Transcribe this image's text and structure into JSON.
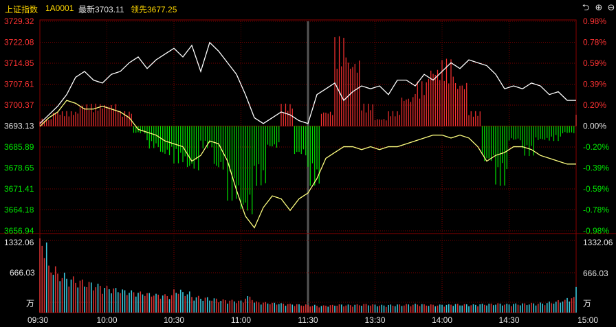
{
  "header": {
    "title": "上证指数",
    "code": "1A0001",
    "latest_label": "最新3703.11",
    "leading_label": "领先3677.25",
    "buttons": [
      "back",
      "zoom-in",
      "zoom-out"
    ]
  },
  "colors": {
    "background": "#000000",
    "up": "#ff3232",
    "down": "#00e600",
    "neutral": "#e6e6e6",
    "index_line": "#ffffff",
    "leading_line": "#ffff80",
    "volume_up": "#d93232",
    "volume_down": "#3cc8dc",
    "grid": "#7a0000"
  },
  "chart_data": {
    "type": "line",
    "base_price": 3693.13,
    "price_ticks": [
      "3729.32",
      "3722.08",
      "3714.85",
      "3707.61",
      "3700.37",
      "3693.13",
      "3685.89",
      "3678.65",
      "3671.41",
      "3664.18",
      "3656.94"
    ],
    "pct_ticks": [
      "0.98%",
      "0.78%",
      "0.59%",
      "0.39%",
      "0.20%",
      "0.00%",
      "-0.20%",
      "-0.39%",
      "-0.59%",
      "-0.78%",
      "-0.98%"
    ],
    "ylim": [
      3656.94,
      3729.32
    ],
    "time_ticks": [
      "09:30",
      "10:00",
      "10:30",
      "11:00",
      "11:30",
      "13:30",
      "14:00",
      "14:30",
      "15:00"
    ],
    "series": [
      {
        "name": "最新",
        "color": "#ffffff",
        "x": [
          0,
          4,
          8,
          12,
          16,
          20,
          24,
          28,
          32,
          36,
          40,
          44,
          48,
          52,
          56,
          60,
          64,
          68,
          72,
          76,
          80,
          84,
          88,
          92,
          96,
          100,
          104,
          108,
          112,
          116,
          120,
          124,
          128,
          132,
          136,
          140,
          144,
          148,
          152,
          156,
          160,
          164,
          168,
          172,
          176,
          180,
          184,
          188,
          192,
          196,
          200,
          204,
          208,
          212,
          216,
          220,
          224,
          228,
          232,
          236,
          240
        ],
        "y": [
          3694,
          3697,
          3700,
          3704,
          3710,
          3712,
          3709,
          3708,
          3711,
          3712,
          3715,
          3717,
          3713,
          3716,
          3718,
          3720,
          3717,
          3721,
          3712,
          3722,
          3719,
          3715,
          3711,
          3704,
          3696,
          3694,
          3696,
          3698,
          3697,
          3695,
          3694,
          3704,
          3706,
          3708,
          3702,
          3705,
          3707,
          3706,
          3707,
          3704,
          3709,
          3709,
          3707,
          3711,
          3709,
          3712,
          3715,
          3713,
          3716,
          3715,
          3714,
          3711,
          3706,
          3707,
          3706,
          3708,
          3707,
          3704,
          3705,
          3702,
          3702
        ]
      },
      {
        "name": "领先",
        "color": "#ffff80",
        "x": [
          0,
          4,
          8,
          12,
          16,
          20,
          24,
          28,
          32,
          36,
          40,
          44,
          48,
          52,
          56,
          60,
          64,
          68,
          72,
          76,
          80,
          84,
          88,
          92,
          96,
          100,
          104,
          108,
          112,
          116,
          120,
          124,
          128,
          132,
          136,
          140,
          144,
          148,
          152,
          156,
          160,
          164,
          168,
          172,
          176,
          180,
          184,
          188,
          192,
          196,
          200,
          204,
          208,
          212,
          216,
          220,
          224,
          228,
          232,
          236,
          240
        ],
        "y": [
          3693,
          3696,
          3698,
          3702,
          3701,
          3699,
          3699,
          3700,
          3699,
          3698,
          3696,
          3692,
          3691,
          3690,
          3688,
          3687,
          3686,
          3681,
          3683,
          3688,
          3687,
          3681,
          3671,
          3662,
          3658,
          3665,
          3669,
          3668,
          3664,
          3668,
          3670,
          3675,
          3682,
          3684,
          3686,
          3686,
          3685,
          3686,
          3685,
          3686,
          3686,
          3687,
          3688,
          3689,
          3690,
          3690,
          3689,
          3690,
          3689,
          3686,
          3681,
          3683,
          3684,
          3686,
          3686,
          3685,
          3683,
          3682,
          3681,
          3680,
          3680
        ]
      }
    ],
    "diff_bars": {
      "x": [
        0,
        6,
        12,
        18,
        24,
        30,
        36,
        42,
        48,
        54,
        60,
        66,
        72,
        78,
        84,
        90,
        96,
        102,
        108,
        114,
        120,
        126,
        132,
        138,
        144,
        150,
        156,
        162,
        168,
        174,
        180,
        186,
        192,
        198,
        204,
        210,
        216,
        222,
        228,
        234,
        240
      ],
      "values": [
        1,
        2,
        2,
        3,
        3,
        3,
        2,
        -1,
        -3,
        -4,
        -5,
        -6,
        -3,
        -6,
        -10,
        -12,
        -8,
        -3,
        3,
        -4,
        -8,
        2,
        12,
        9,
        3,
        1,
        2,
        4,
        6,
        8,
        9,
        6,
        2,
        -5,
        -8,
        -2,
        -4,
        -2,
        -2,
        -1,
        2
      ]
    },
    "volume": {
      "unit": "万",
      "ylim": [
        0,
        1332.06
      ],
      "ticks": [
        "1332.06",
        "666.03"
      ],
      "x": [
        0,
        4,
        8,
        12,
        16,
        20,
        24,
        28,
        32,
        36,
        40,
        44,
        48,
        52,
        56,
        60,
        64,
        68,
        72,
        76,
        80,
        84,
        88,
        92,
        96,
        100,
        104,
        108,
        112,
        116,
        120,
        124,
        128,
        132,
        136,
        140,
        144,
        148,
        152,
        156,
        160,
        164,
        168,
        172,
        176,
        180,
        184,
        188,
        192,
        196,
        200,
        204,
        208,
        212,
        216,
        220,
        224,
        228,
        232,
        236,
        240
      ],
      "values": [
        1332,
        850,
        720,
        650,
        600,
        560,
        520,
        480,
        450,
        420,
        400,
        380,
        360,
        340,
        330,
        420,
        380,
        300,
        280,
        260,
        240,
        230,
        220,
        300,
        200,
        190,
        180,
        170,
        160,
        150,
        140,
        130,
        140,
        150,
        145,
        150,
        160,
        150,
        140,
        145,
        150,
        155,
        160,
        150,
        145,
        150,
        160,
        155,
        150,
        160,
        165,
        170,
        160,
        165,
        170,
        175,
        180,
        200,
        230,
        280,
        520
      ],
      "directions": [
        1,
        1,
        1,
        -1,
        1,
        -1,
        1,
        1,
        -1,
        1,
        -1,
        -1,
        1,
        -1,
        1,
        1,
        -1,
        1,
        -1,
        -1,
        1,
        -1,
        1,
        1,
        -1,
        1,
        1,
        -1,
        1,
        -1,
        1,
        1,
        1,
        -1,
        1,
        1,
        -1,
        1,
        1,
        -1,
        -1,
        1,
        -1,
        1,
        1,
        -1,
        1,
        -1,
        -1,
        1,
        -1,
        -1,
        1,
        -1,
        -1,
        1,
        -1,
        -1,
        1,
        -1,
        -1
      ]
    }
  }
}
